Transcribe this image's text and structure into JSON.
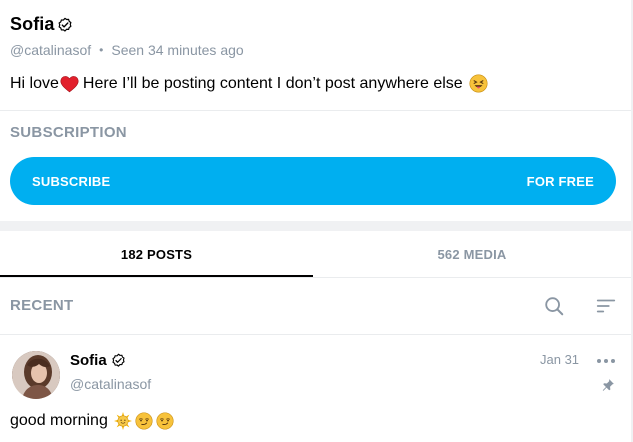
{
  "profile": {
    "name": "Sofia",
    "handle": "@catalinasof",
    "separator": "•",
    "last_seen": "Seen 34 minutes ago",
    "bio_before": "Hi love",
    "bio_after": "Here I’ll be posting content I don’t post anywhere else",
    "bio_emojis": [
      "red-heart",
      "face-with-tongue"
    ]
  },
  "subscription": {
    "title": "SUBSCRIPTION",
    "button_label": "SUBSCRIBE",
    "price_label": "FOR FREE"
  },
  "tabs": [
    {
      "label": "182 POSTS",
      "active": true
    },
    {
      "label": "562 MEDIA",
      "active": false
    }
  ],
  "feed": {
    "title": "RECENT",
    "icons": [
      "search-icon",
      "sort-icon"
    ]
  },
  "post": {
    "author_name": "Sofia",
    "author_handle": "@catalinasof",
    "date": "Jan 31",
    "text": "good morning",
    "emojis": [
      "sun-with-face",
      "smirking-face",
      "smirking-face"
    ],
    "pinned": true
  },
  "colors": {
    "accent": "#00aff0",
    "muted_text": "#8a96a3",
    "divider": "#eaecee",
    "section_bg": "#f0f1f3"
  }
}
